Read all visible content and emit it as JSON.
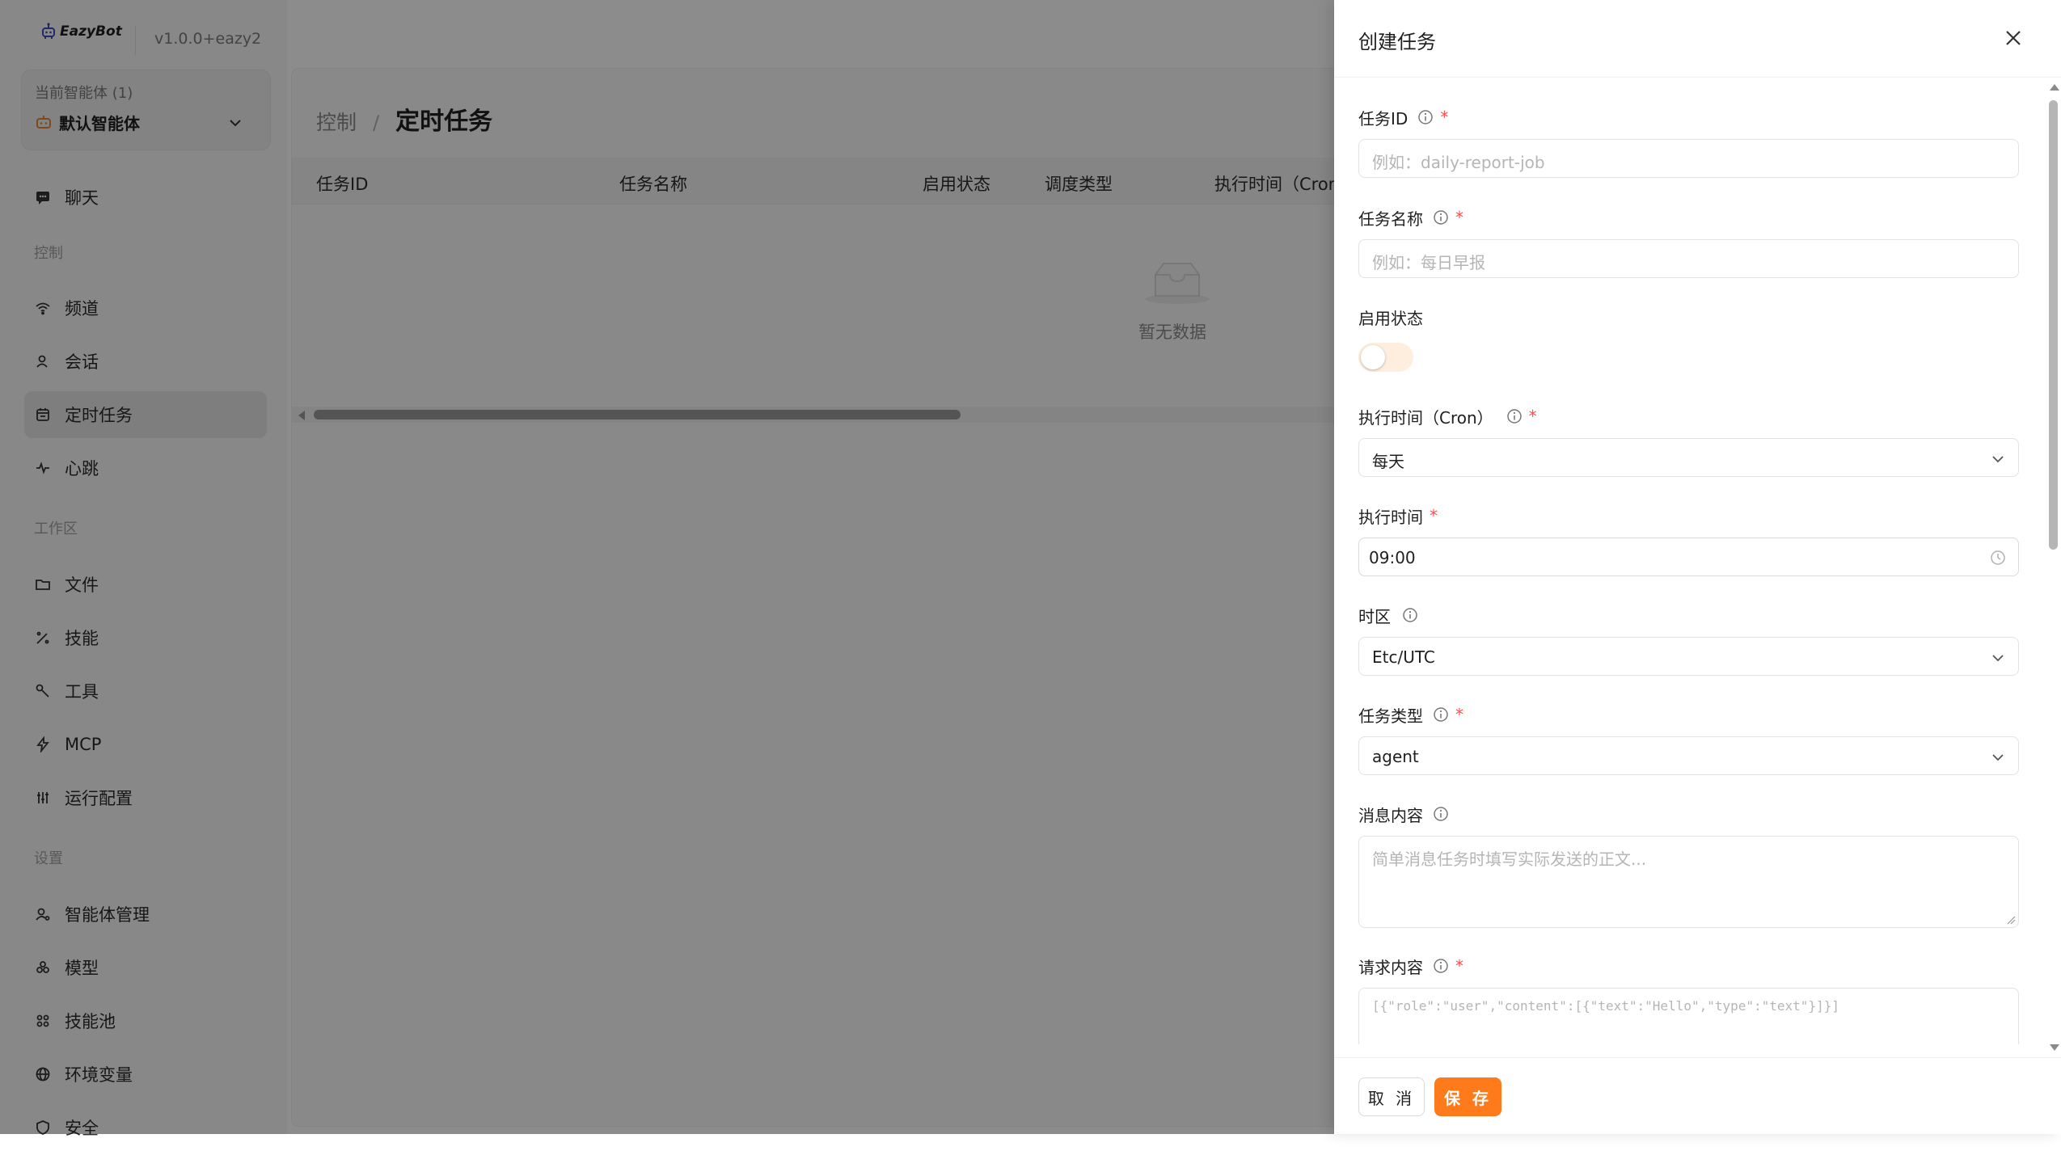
{
  "app": {
    "brand": "EazyBot",
    "version": "v1.0.0+eazy2"
  },
  "agent": {
    "count_label": "当前智能体 (1)",
    "name": "默认智能体"
  },
  "sidebar": {
    "chat": "聊天",
    "sections": {
      "control": "控制",
      "workspace": "工作区",
      "settings": "设置"
    },
    "control_items": [
      "频道",
      "会话",
      "定时任务",
      "心跳"
    ],
    "workspace_items": [
      "文件",
      "技能",
      "工具",
      "MCP",
      "运行配置"
    ],
    "settings_items": [
      "智能体管理",
      "模型",
      "技能池",
      "环境变量",
      "安全"
    ]
  },
  "main": {
    "breadcrumb": {
      "parent": "控制",
      "separator": "/",
      "current": "定时任务"
    },
    "table": {
      "columns": [
        "任务ID",
        "任务名称",
        "启用状态",
        "调度类型",
        "执行时间（Cron"
      ],
      "empty_text": "暂无数据"
    }
  },
  "drawer": {
    "title": "创建任务",
    "fields": {
      "task_id": {
        "label": "任务ID",
        "placeholder": "例如：daily-report-job"
      },
      "task_name": {
        "label": "任务名称",
        "placeholder": "例如：每日早报"
      },
      "enabled": {
        "label": "启用状态",
        "value": false
      },
      "cron": {
        "label": "执行时间（Cron）",
        "value": "每天"
      },
      "exec_time": {
        "label": "执行时间",
        "value": "09:00"
      },
      "timezone": {
        "label": "时区",
        "value": "Etc/UTC"
      },
      "task_type": {
        "label": "任务类型",
        "value": "agent"
      },
      "message": {
        "label": "消息内容",
        "placeholder": "简单消息任务时填写实际发送的正文..."
      },
      "request": {
        "label": "请求内容",
        "placeholder": "[{\"role\":\"user\",\"content\":[{\"text\":\"Hello\",\"type\":\"text\"}]}]"
      }
    },
    "required_mark": "*",
    "buttons": {
      "cancel": "取 消",
      "save": "保 存"
    }
  },
  "colors": {
    "accent": "#ff7a1a",
    "required": "#ff4d4f",
    "overlay": "rgba(0,0,0,0.45)",
    "switch_off": "#fdeedd"
  },
  "icons": {
    "chat": "chat-bubble-icon",
    "channel": "wifi-icon",
    "session": "user-icon",
    "scheduled": "calendar-icon",
    "heartbeat": "pulse-icon",
    "files": "folder-icon",
    "skills": "magic-wand-icon",
    "tools": "wrench-icon",
    "mcp": "lightning-icon",
    "runtime": "sliders-icon",
    "agent_mgmt": "user-settings-icon",
    "models": "cube-icon",
    "skill_pool": "grid-icon",
    "env": "globe-icon",
    "security": "shield-icon"
  }
}
